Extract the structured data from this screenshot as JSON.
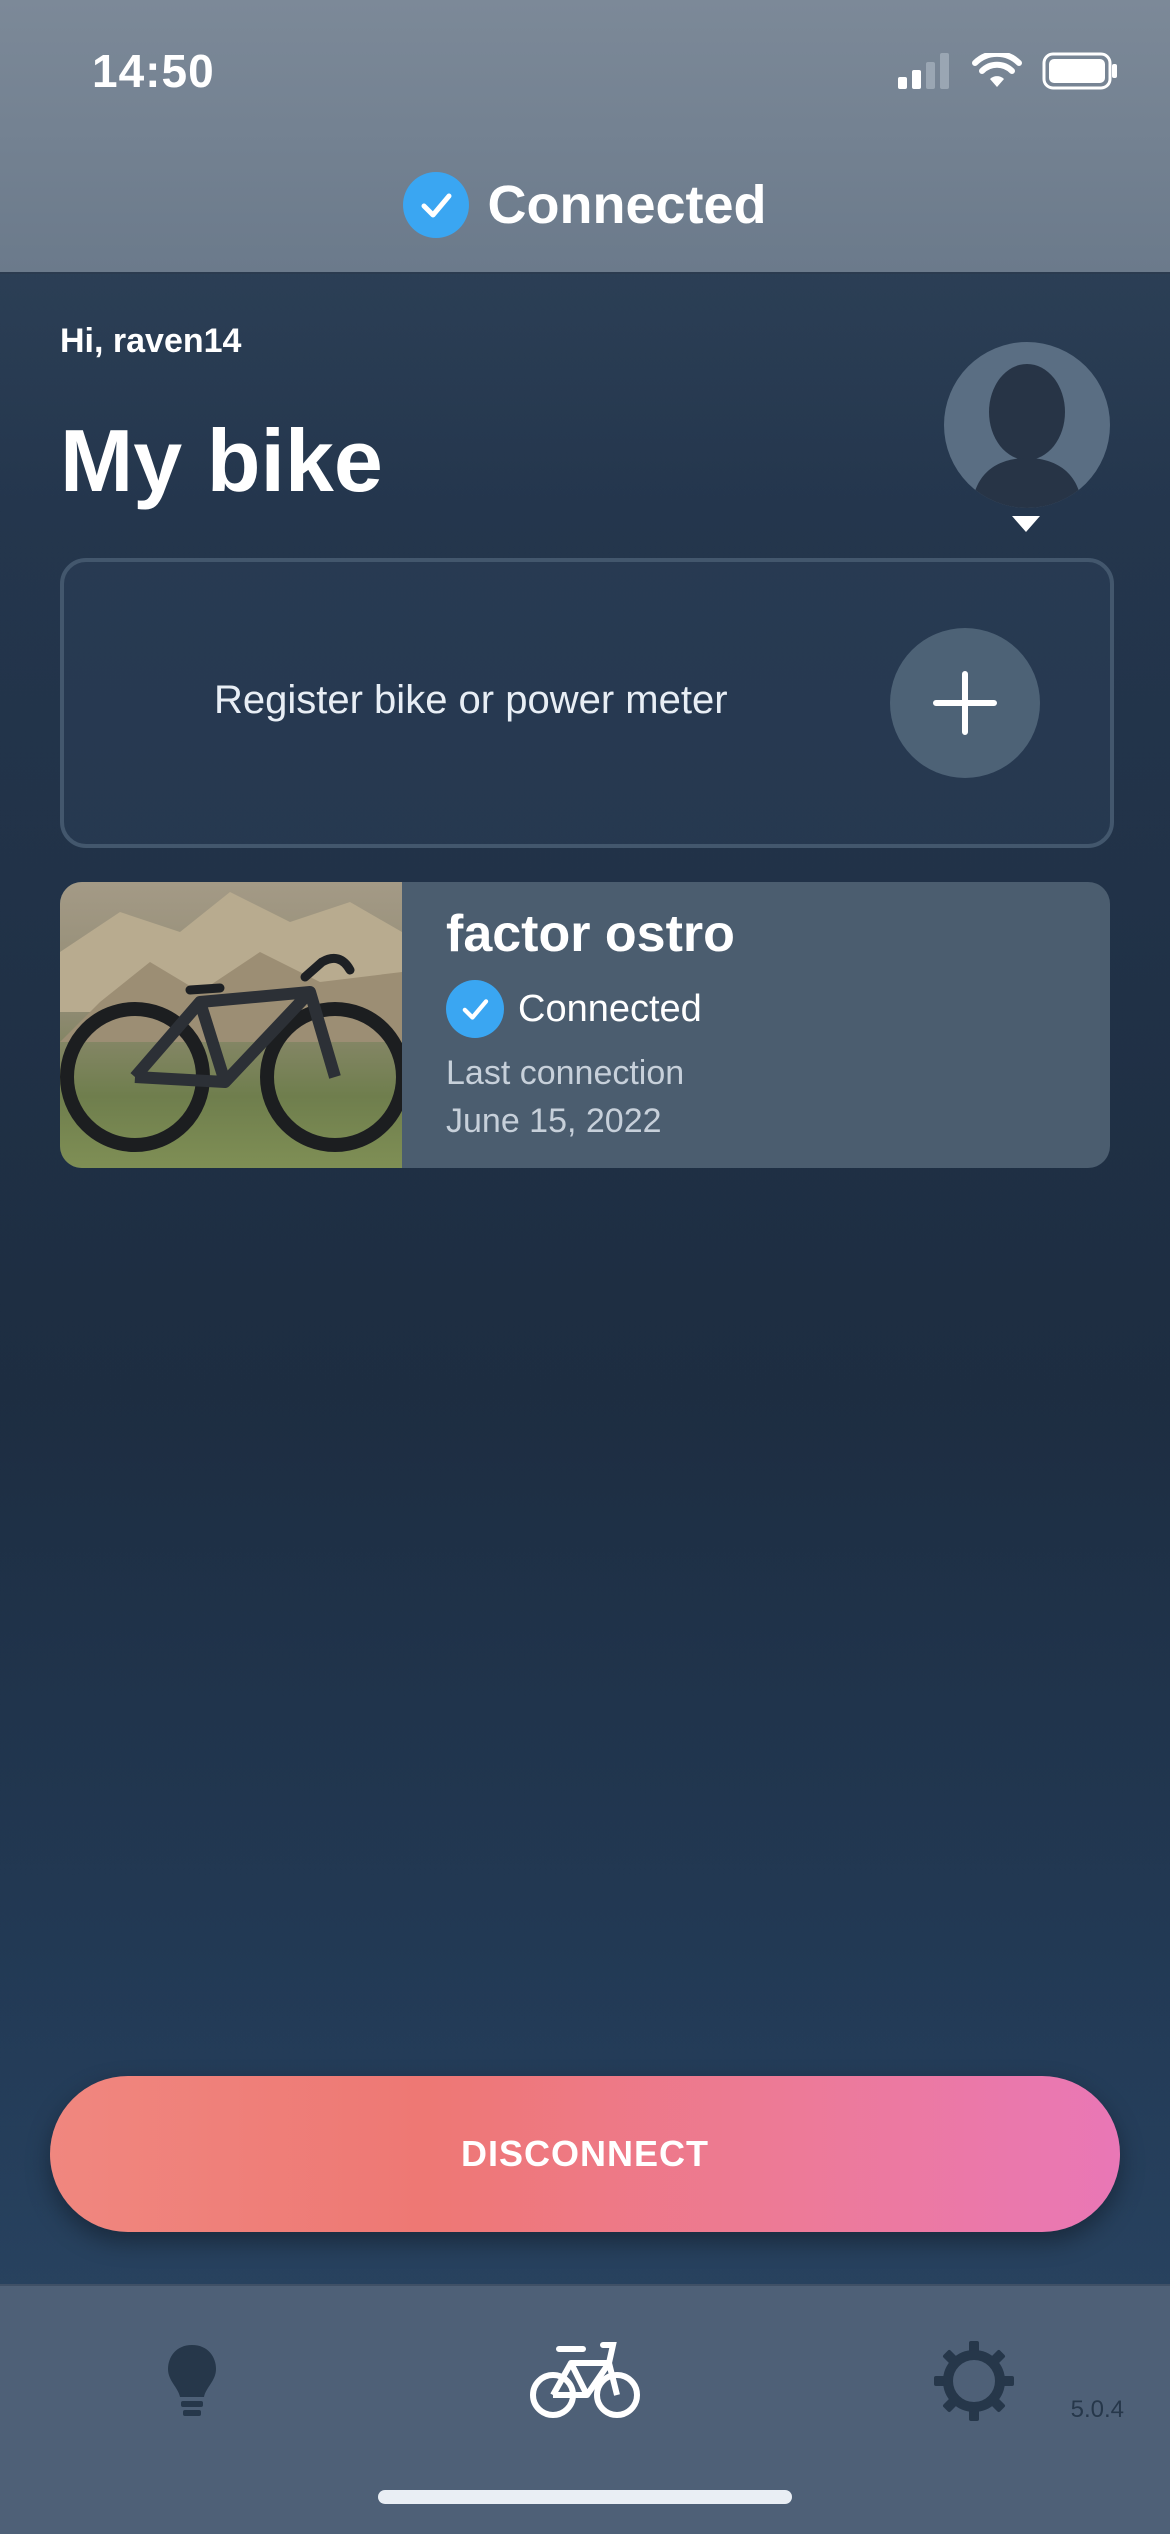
{
  "status_bar": {
    "time": "14:50"
  },
  "header": {
    "connection_label": "Connected"
  },
  "greeting": "Hi, raven14",
  "page_title": "My bike",
  "register": {
    "label": "Register bike or power meter"
  },
  "bike": {
    "name": "factor ostro",
    "status": "Connected",
    "last_connection_label": "Last connection",
    "last_connection_date": "June 15, 2022"
  },
  "disconnect_label": "DISCONNECT",
  "tabbar": {
    "tabs": [
      {
        "icon": "lightbulb-icon"
      },
      {
        "icon": "bicycle-icon"
      },
      {
        "icon": "gear-icon"
      }
    ],
    "version": "5.0.4"
  },
  "colors": {
    "accent_check": "#3aa6f2",
    "disconnect_start": "#f0877f",
    "disconnect_end": "#e977b6"
  }
}
